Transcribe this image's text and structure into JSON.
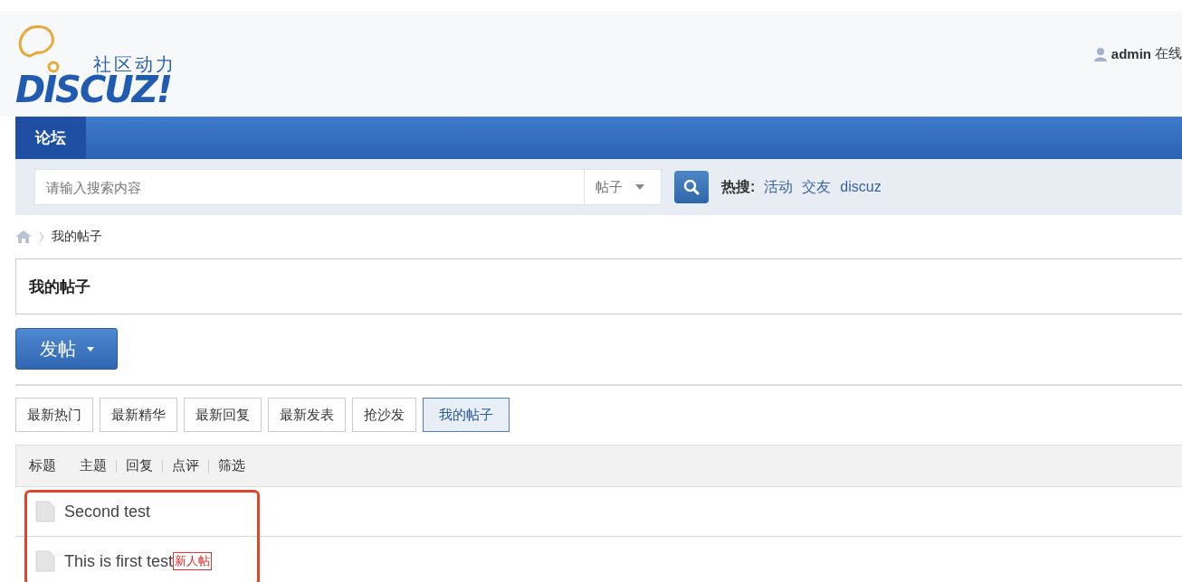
{
  "logo": {
    "tagline": "社区动力",
    "wordmark": "DISCUZ!"
  },
  "user": {
    "name": "admin",
    "status": "在线"
  },
  "nav": [
    {
      "label": "论坛",
      "selected": true
    }
  ],
  "search": {
    "placeholder": "请输入搜索内容",
    "scope": "帖子",
    "hot_label": "热搜:",
    "hot_links": [
      "活动",
      "交友",
      "discuz"
    ]
  },
  "breadcrumb": [
    "我的帖子"
  ],
  "page_title": "我的帖子",
  "post_button": "发帖",
  "tabs": [
    {
      "label": "最新热门",
      "selected": false
    },
    {
      "label": "最新精华",
      "selected": false
    },
    {
      "label": "最新回复",
      "selected": false
    },
    {
      "label": "最新发表",
      "selected": false
    },
    {
      "label": "抢沙发",
      "selected": false
    },
    {
      "label": "我的帖子",
      "selected": true
    }
  ],
  "table": {
    "title_label": "标题",
    "filters": [
      "主题",
      "回复",
      "点评",
      "筛选"
    ],
    "rows": [
      {
        "title": "Second test"
      },
      {
        "title": "This is first test",
        "badge": "新人帖"
      }
    ]
  }
}
